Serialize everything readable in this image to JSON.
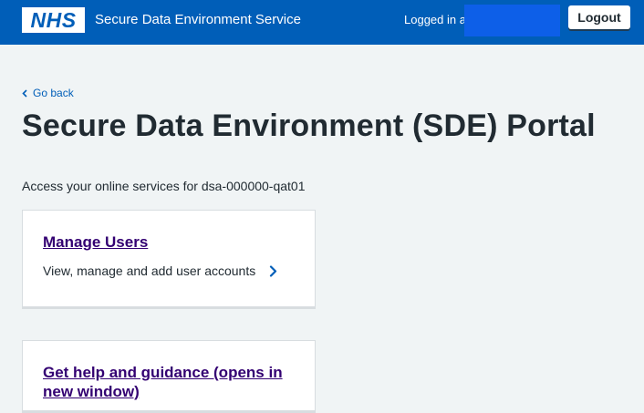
{
  "header": {
    "logo_text": "NHS",
    "service_name": "Secure Data Environment Service",
    "logged_in_label": "Logged in as",
    "logout_label": "Logout",
    "brand_color": "#005eb8"
  },
  "nav": {
    "back_label": "Go back"
  },
  "main": {
    "title": "Secure Data Environment (SDE) Portal",
    "intro": "Access your online services for dsa-000000-qat01",
    "cards": [
      {
        "heading": "Manage Users",
        "description": "View, manage and add user accounts",
        "icon": "chevron-right-icon"
      },
      {
        "heading": "Get help and guidance (opens in new window)",
        "icon": "external-link"
      }
    ]
  }
}
